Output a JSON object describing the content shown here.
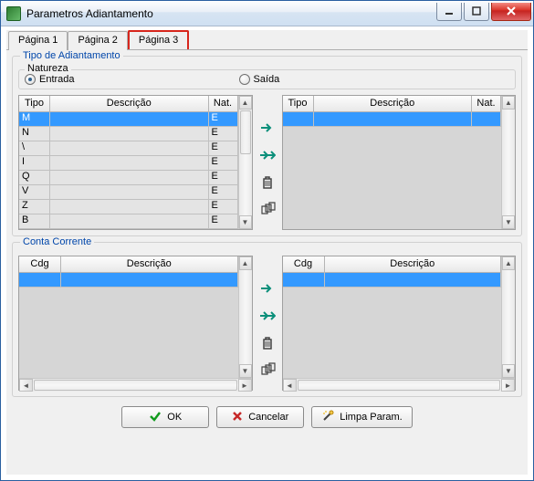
{
  "window": {
    "title": "Parametros Adiantamento"
  },
  "tabs": [
    {
      "label": "Página 1",
      "active": false
    },
    {
      "label": "Página 2",
      "active": false
    },
    {
      "label": "Página 3",
      "active": true
    }
  ],
  "groupbox1": {
    "legend": "Tipo de Adiantamento",
    "natureza": {
      "legend": "Natureza",
      "entrada": "Entrada",
      "saida": "Saída",
      "selected": "entrada"
    },
    "left_headers": {
      "tipo": "Tipo",
      "desc": "Descrição",
      "nat": "Nat."
    },
    "right_headers": {
      "tipo": "Tipo",
      "desc": "Descrição",
      "nat": "Nat."
    },
    "left_rows": [
      {
        "tipo": "M",
        "desc": "",
        "nat": "E"
      },
      {
        "tipo": "N",
        "desc": "",
        "nat": "E"
      },
      {
        "tipo": "\\",
        "desc": "",
        "nat": "E"
      },
      {
        "tipo": "I",
        "desc": "",
        "nat": "E"
      },
      {
        "tipo": "Q",
        "desc": "",
        "nat": "E"
      },
      {
        "tipo": "V",
        "desc": "",
        "nat": "E"
      },
      {
        "tipo": "Z",
        "desc": "",
        "nat": "E"
      },
      {
        "tipo": "B",
        "desc": "",
        "nat": "E"
      }
    ],
    "right_rows": []
  },
  "groupbox2": {
    "legend": "Conta Corrente",
    "left_headers": {
      "cdg": "Cdg",
      "desc": "Descrição"
    },
    "right_headers": {
      "cdg": "Cdg",
      "desc": "Descrição"
    }
  },
  "buttons": {
    "ok": "OK",
    "cancel": "Cancelar",
    "limpa": "Limpa Param."
  }
}
